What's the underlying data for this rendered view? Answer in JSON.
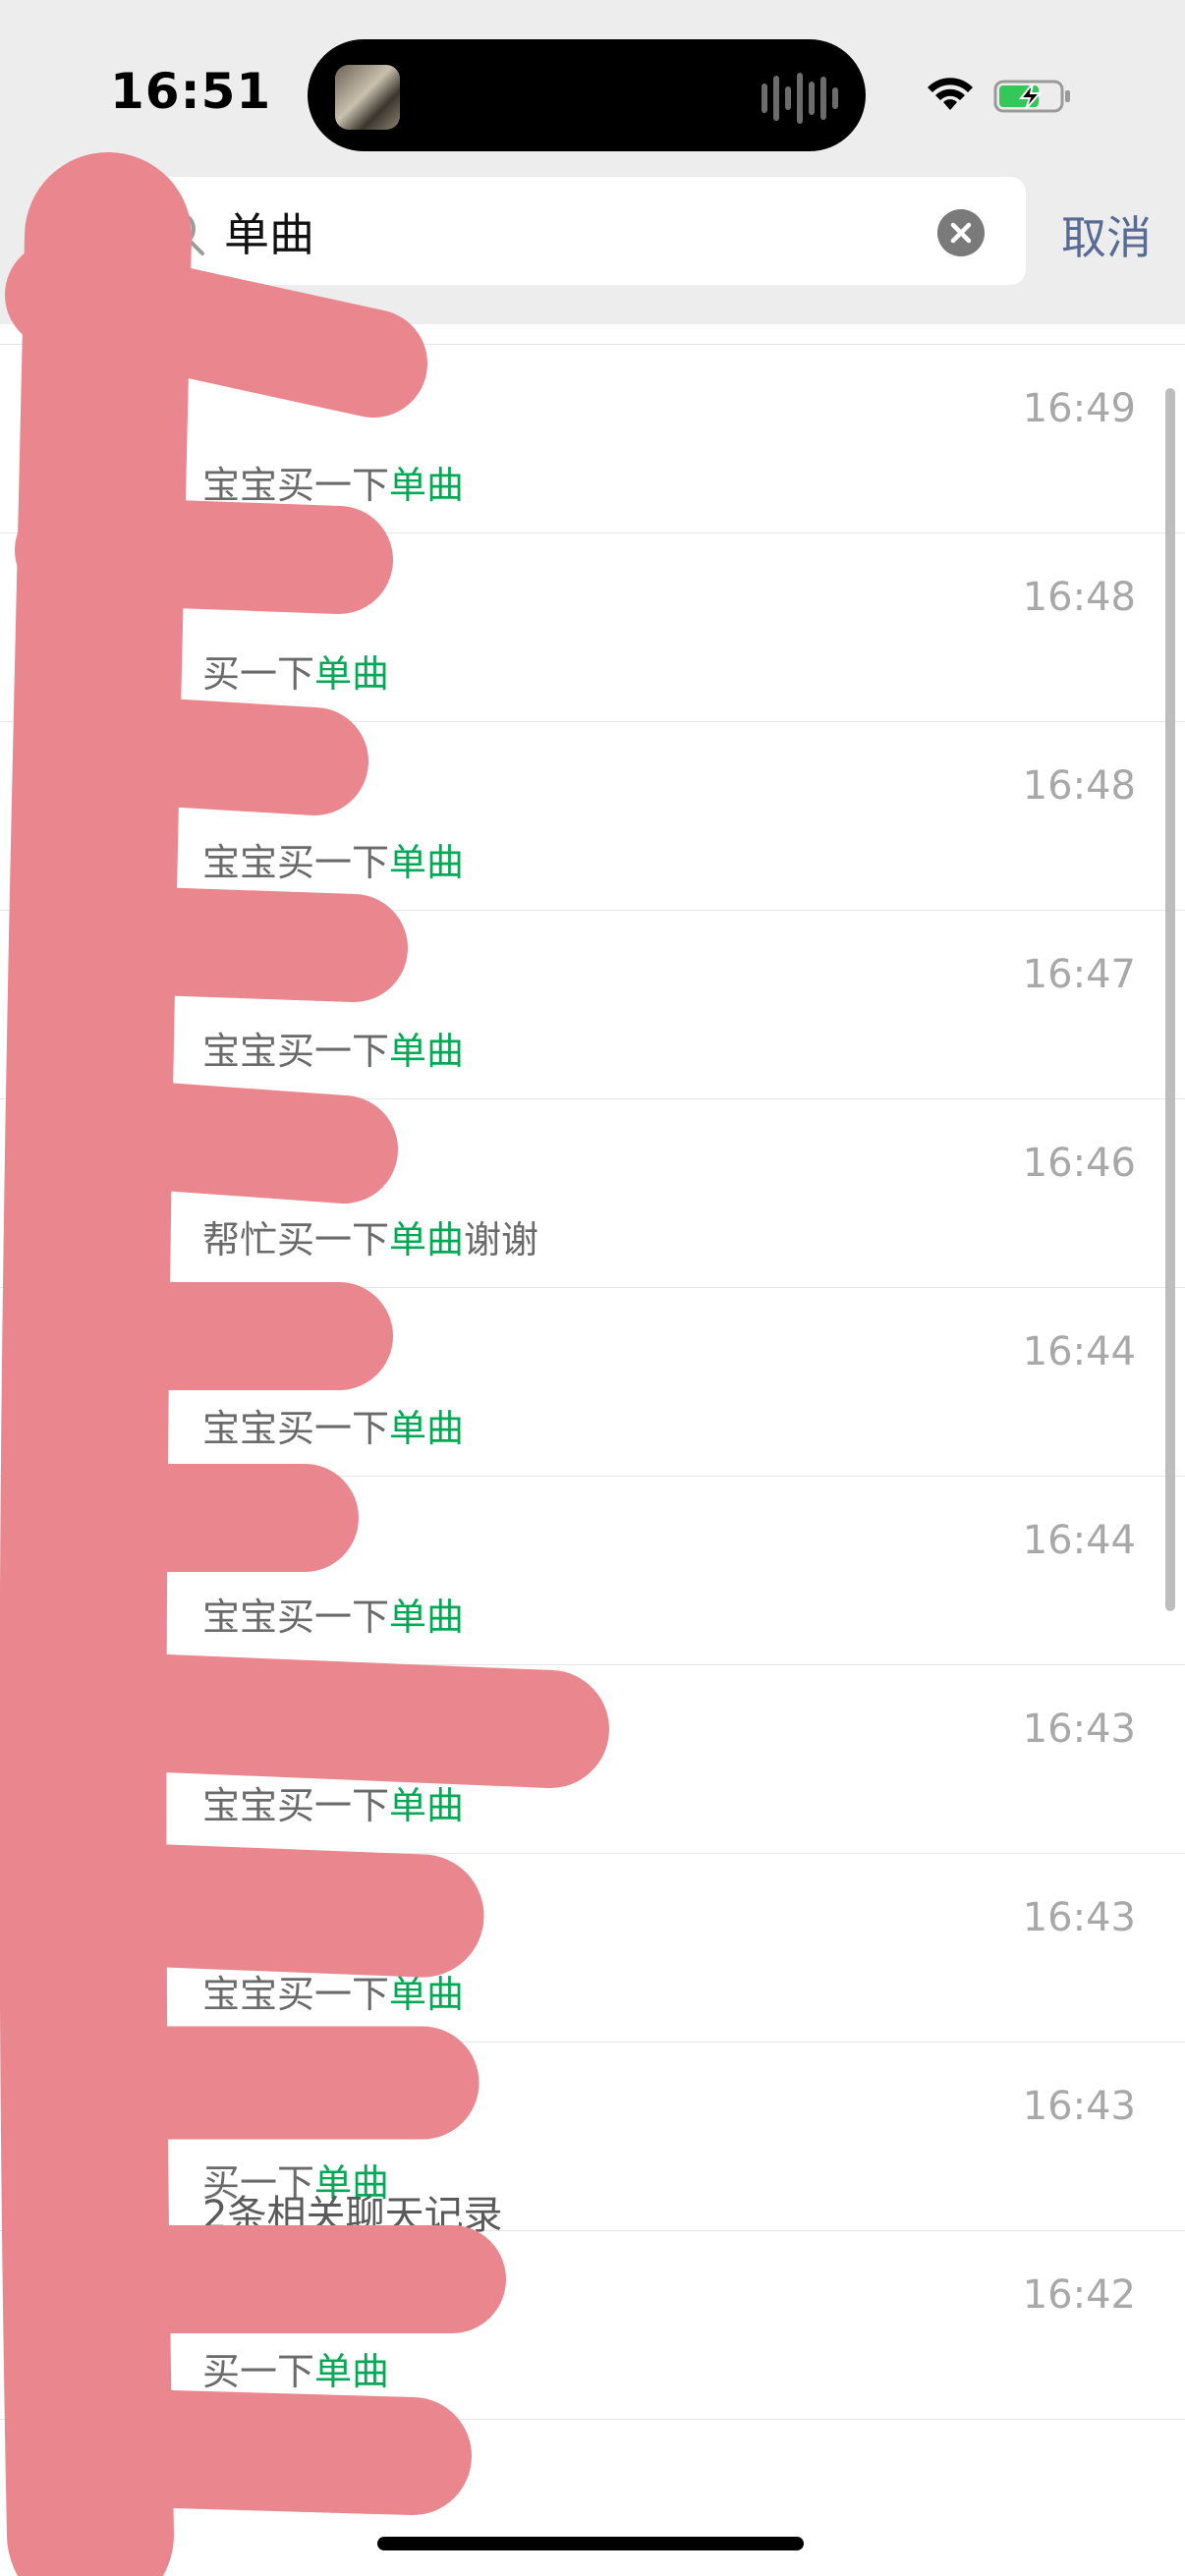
{
  "status_bar": {
    "time": "16:51",
    "icons": [
      "album-art-icon",
      "audio-wave-icon",
      "wifi-icon",
      "battery-charging-icon"
    ]
  },
  "search": {
    "query": "单曲",
    "cancel_label": "取消",
    "icons": [
      "back-arrow-icon",
      "search-icon",
      "clear-icon"
    ]
  },
  "results": [
    {
      "time": "16:49",
      "prefix": "宝宝买一下",
      "highlight": "单曲",
      "suffix": ""
    },
    {
      "time": "16:48",
      "prefix": "买一下",
      "highlight": "单曲",
      "suffix": ""
    },
    {
      "time": "16:48",
      "prefix": "宝宝买一下",
      "highlight": "单曲",
      "suffix": ""
    },
    {
      "time": "16:47",
      "prefix": "宝宝买一下",
      "highlight": "单曲",
      "suffix": ""
    },
    {
      "time": "16:46",
      "prefix": "帮忙买一下",
      "highlight": "单曲",
      "suffix": "谢谢"
    },
    {
      "time": "16:44",
      "prefix": "宝宝买一下",
      "highlight": "单曲",
      "suffix": ""
    },
    {
      "time": "16:44",
      "prefix": "宝宝买一下",
      "highlight": "单曲",
      "suffix": ""
    },
    {
      "time": "16:43",
      "prefix": "宝宝买一下",
      "highlight": "单曲",
      "suffix": ""
    },
    {
      "time": "16:43",
      "prefix": "宝宝买一下",
      "highlight": "单曲",
      "suffix": ""
    },
    {
      "time": "16:43",
      "prefix": "买一下",
      "highlight": "单曲",
      "suffix": ""
    },
    {
      "time": "16:42",
      "prefix": "买一下",
      "highlight": "单曲",
      "suffix": ""
    }
  ],
  "footer": {
    "text": "2条相关聊天记录"
  },
  "colors": {
    "highlight": "#07a855",
    "cancel": "#576b95",
    "redaction": "#ea868d"
  }
}
